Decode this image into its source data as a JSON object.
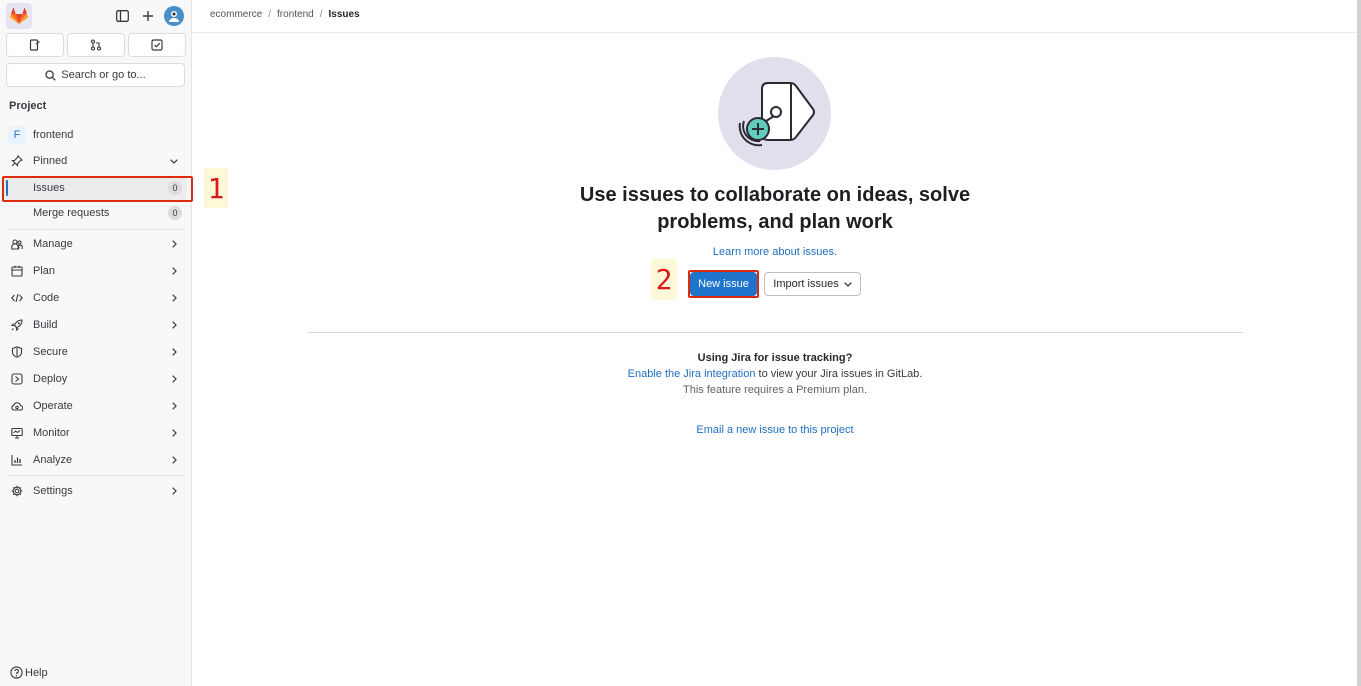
{
  "sidebar": {
    "section_title": "Project",
    "search_label": "Search or go to...",
    "project": {
      "badge": "F",
      "name": "frontend"
    },
    "pinned": {
      "label": "Pinned",
      "items": [
        {
          "label": "Issues",
          "count": "0"
        },
        {
          "label": "Merge requests",
          "count": "0"
        }
      ]
    },
    "menu": [
      {
        "label": "Manage",
        "icon": "users-icon"
      },
      {
        "label": "Plan",
        "icon": "calendar-icon"
      },
      {
        "label": "Code",
        "icon": "code-icon"
      },
      {
        "label": "Build",
        "icon": "rocket-icon"
      },
      {
        "label": "Secure",
        "icon": "shield-icon"
      },
      {
        "label": "Deploy",
        "icon": "deploy-icon"
      },
      {
        "label": "Operate",
        "icon": "cloud-icon"
      },
      {
        "label": "Monitor",
        "icon": "monitor-icon"
      },
      {
        "label": "Analyze",
        "icon": "chart-icon"
      }
    ],
    "settings_label": "Settings",
    "help_label": "Help"
  },
  "breadcrumb": [
    "ecommerce",
    "frontend",
    "Issues"
  ],
  "empty_state": {
    "title": "Use issues to collaborate on ideas, solve problems, and plan work",
    "learn_more": "Learn more about issues.",
    "new_issue": "New issue",
    "import_issues": "Import issues"
  },
  "jira": {
    "question": "Using Jira for issue tracking?",
    "link_text": "Enable the Jira integration",
    "rest": " to view your Jira issues in GitLab.",
    "premium": "This feature requires a Premium plan."
  },
  "email_link": "Email a new issue to this project",
  "annotations": [
    "1",
    "2"
  ],
  "colors": {
    "primary": "#1f75cb",
    "annotation": "#dd2b0e",
    "gitlab_orange": "#e24329"
  }
}
